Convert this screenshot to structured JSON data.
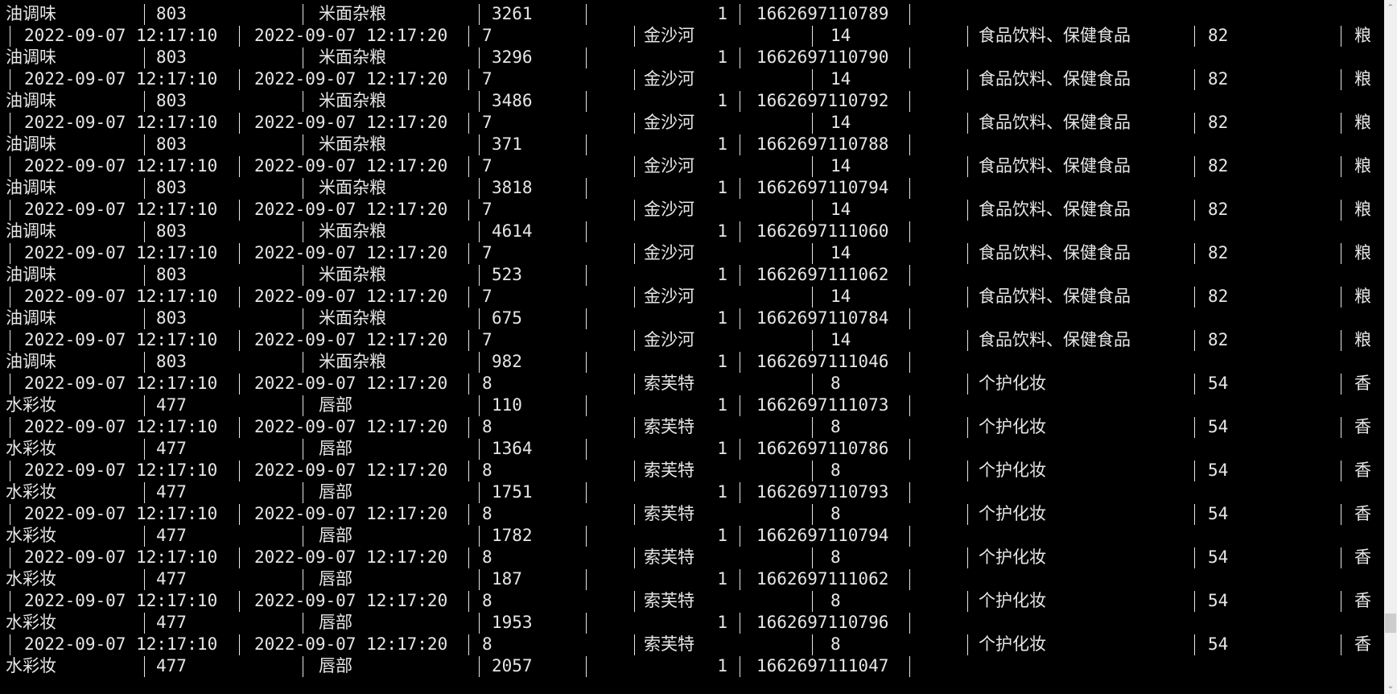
{
  "window": {
    "type": "terminal",
    "background": "#000000",
    "foreground": "#e6e6e6"
  },
  "scrollbar": {
    "up_icon": "⌃",
    "down_icon": "⌄",
    "thumb_position_fraction": 0.93
  },
  "lines": [
    {
      "kind": "B",
      "cells": [
        "油调味",
        "803",
        "米面杂粮",
        "3261",
        "1",
        "1662697110789"
      ]
    },
    {
      "kind": "A",
      "cells": [
        "2022-09-07 12:17:10",
        "2022-09-07 12:17:20",
        "7",
        "金沙河",
        "14",
        "食品饮料、保健食品",
        "82",
        "粮"
      ]
    },
    {
      "kind": "B",
      "cells": [
        "油调味",
        "803",
        "米面杂粮",
        "3296",
        "1",
        "1662697110790"
      ]
    },
    {
      "kind": "A",
      "cells": [
        "2022-09-07 12:17:10",
        "2022-09-07 12:17:20",
        "7",
        "金沙河",
        "14",
        "食品饮料、保健食品",
        "82",
        "粮"
      ]
    },
    {
      "kind": "B",
      "cells": [
        "油调味",
        "803",
        "米面杂粮",
        "3486",
        "1",
        "1662697110792"
      ]
    },
    {
      "kind": "A",
      "cells": [
        "2022-09-07 12:17:10",
        "2022-09-07 12:17:20",
        "7",
        "金沙河",
        "14",
        "食品饮料、保健食品",
        "82",
        "粮"
      ]
    },
    {
      "kind": "B",
      "cells": [
        "油调味",
        "803",
        "米面杂粮",
        "371",
        "1",
        "1662697110788"
      ]
    },
    {
      "kind": "A",
      "cells": [
        "2022-09-07 12:17:10",
        "2022-09-07 12:17:20",
        "7",
        "金沙河",
        "14",
        "食品饮料、保健食品",
        "82",
        "粮"
      ]
    },
    {
      "kind": "B",
      "cells": [
        "油调味",
        "803",
        "米面杂粮",
        "3818",
        "1",
        "1662697110794"
      ]
    },
    {
      "kind": "A",
      "cells": [
        "2022-09-07 12:17:10",
        "2022-09-07 12:17:20",
        "7",
        "金沙河",
        "14",
        "食品饮料、保健食品",
        "82",
        "粮"
      ]
    },
    {
      "kind": "B",
      "cells": [
        "油调味",
        "803",
        "米面杂粮",
        "4614",
        "1",
        "1662697111060"
      ]
    },
    {
      "kind": "A",
      "cells": [
        "2022-09-07 12:17:10",
        "2022-09-07 12:17:20",
        "7",
        "金沙河",
        "14",
        "食品饮料、保健食品",
        "82",
        "粮"
      ]
    },
    {
      "kind": "B",
      "cells": [
        "油调味",
        "803",
        "米面杂粮",
        "523",
        "1",
        "1662697111062"
      ]
    },
    {
      "kind": "A",
      "cells": [
        "2022-09-07 12:17:10",
        "2022-09-07 12:17:20",
        "7",
        "金沙河",
        "14",
        "食品饮料、保健食品",
        "82",
        "粮"
      ]
    },
    {
      "kind": "B",
      "cells": [
        "油调味",
        "803",
        "米面杂粮",
        "675",
        "1",
        "1662697110784"
      ]
    },
    {
      "kind": "A",
      "cells": [
        "2022-09-07 12:17:10",
        "2022-09-07 12:17:20",
        "7",
        "金沙河",
        "14",
        "食品饮料、保健食品",
        "82",
        "粮"
      ]
    },
    {
      "kind": "B",
      "cells": [
        "油调味",
        "803",
        "米面杂粮",
        "982",
        "1",
        "1662697111046"
      ]
    },
    {
      "kind": "A",
      "cells": [
        "2022-09-07 12:17:10",
        "2022-09-07 12:17:20",
        "8",
        "索芙特",
        "8",
        "个护化妆",
        "54",
        "香"
      ]
    },
    {
      "kind": "B",
      "cells": [
        "水彩妆",
        "477",
        "唇部",
        "110",
        "1",
        "1662697111073"
      ]
    },
    {
      "kind": "A",
      "cells": [
        "2022-09-07 12:17:10",
        "2022-09-07 12:17:20",
        "8",
        "索芙特",
        "8",
        "个护化妆",
        "54",
        "香"
      ]
    },
    {
      "kind": "B",
      "cells": [
        "水彩妆",
        "477",
        "唇部",
        "1364",
        "1",
        "1662697110786"
      ]
    },
    {
      "kind": "A",
      "cells": [
        "2022-09-07 12:17:10",
        "2022-09-07 12:17:20",
        "8",
        "索芙特",
        "8",
        "个护化妆",
        "54",
        "香"
      ]
    },
    {
      "kind": "B",
      "cells": [
        "水彩妆",
        "477",
        "唇部",
        "1751",
        "1",
        "1662697110793"
      ]
    },
    {
      "kind": "A",
      "cells": [
        "2022-09-07 12:17:10",
        "2022-09-07 12:17:20",
        "8",
        "索芙特",
        "8",
        "个护化妆",
        "54",
        "香"
      ]
    },
    {
      "kind": "B",
      "cells": [
        "水彩妆",
        "477",
        "唇部",
        "1782",
        "1",
        "1662697110794"
      ]
    },
    {
      "kind": "A",
      "cells": [
        "2022-09-07 12:17:10",
        "2022-09-07 12:17:20",
        "8",
        "索芙特",
        "8",
        "个护化妆",
        "54",
        "香"
      ]
    },
    {
      "kind": "B",
      "cells": [
        "水彩妆",
        "477",
        "唇部",
        "187",
        "1",
        "1662697111062"
      ]
    },
    {
      "kind": "A",
      "cells": [
        "2022-09-07 12:17:10",
        "2022-09-07 12:17:20",
        "8",
        "索芙特",
        "8",
        "个护化妆",
        "54",
        "香"
      ]
    },
    {
      "kind": "B",
      "cells": [
        "水彩妆",
        "477",
        "唇部",
        "1953",
        "1",
        "1662697110796"
      ]
    },
    {
      "kind": "A",
      "cells": [
        "2022-09-07 12:17:10",
        "2022-09-07 12:17:20",
        "8",
        "索芙特",
        "8",
        "个护化妆",
        "54",
        "香"
      ]
    },
    {
      "kind": "B",
      "cells": [
        "水彩妆",
        "477",
        "唇部",
        "2057",
        "1",
        "1662697111047"
      ]
    }
  ]
}
